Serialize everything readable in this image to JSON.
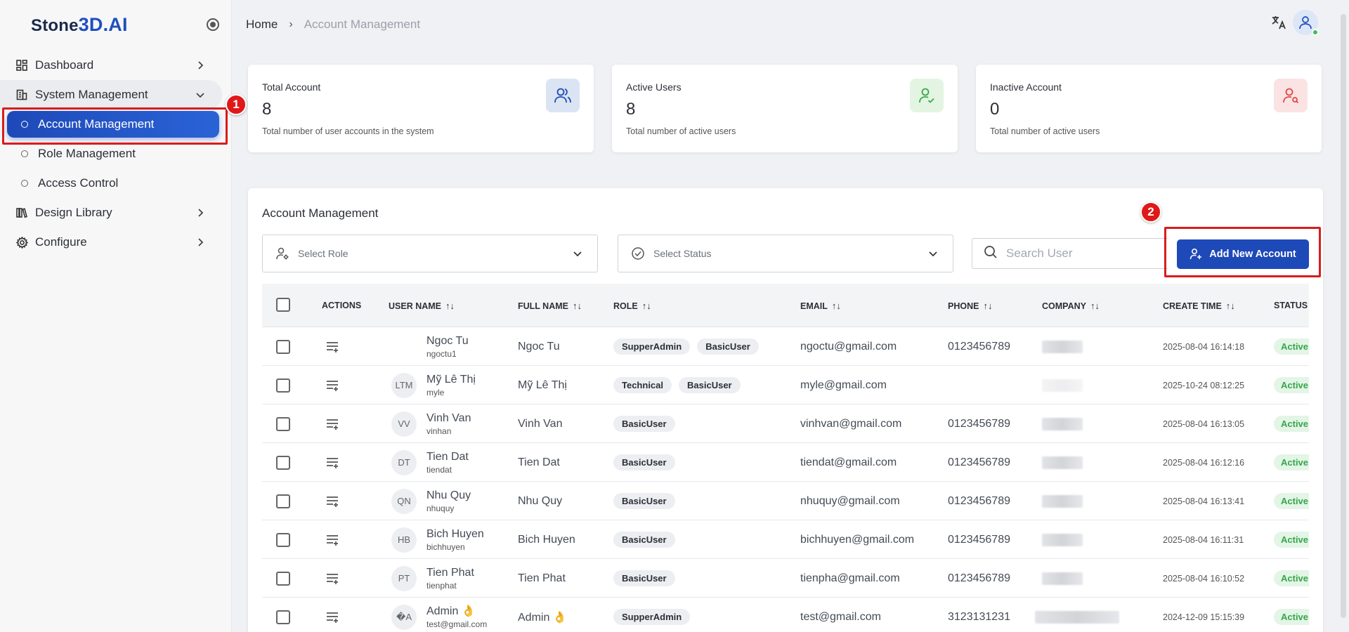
{
  "app": {
    "logo_prefix": "Stone",
    "logo_accent": "3D.AI"
  },
  "sidebar": {
    "items": [
      {
        "label": "Dashboard",
        "icon": "dashboard-icon"
      },
      {
        "label": "System Management",
        "icon": "building-icon"
      },
      {
        "label": "Account Management"
      },
      {
        "label": "Role Management"
      },
      {
        "label": "Access Control"
      },
      {
        "label": "Design Library",
        "icon": "library-icon"
      },
      {
        "label": "Configure",
        "icon": "gear-icon"
      }
    ]
  },
  "header": {
    "breadcrumb_home": "Home",
    "breadcrumb_sep": "›",
    "breadcrumb_current": "Account Management"
  },
  "annotations": {
    "one": "1",
    "two": "2"
  },
  "stats": [
    {
      "title": "Total Account",
      "value": "8",
      "desc": "Total number of user accounts in the system",
      "accent": "#dbe4f3"
    },
    {
      "title": "Active Users",
      "value": "8",
      "desc": "Total number of active users",
      "accent": "#e3f5e2"
    },
    {
      "title": "Inactive Account",
      "value": "0",
      "desc": "Total number of active users",
      "accent": "#fbe3e3"
    }
  ],
  "panel": {
    "title": "Account Management",
    "select_role": "Select Role",
    "select_status": "Select Status",
    "search_placeholder": "Search User",
    "add_button": "Add New Account"
  },
  "table": {
    "headers": {
      "actions": "ACTIONS",
      "username": "USER NAME",
      "fullname": "FULL NAME",
      "role": "ROLE",
      "email": "EMAIL",
      "phone": "PHONE",
      "company": "COMPANY",
      "created": "CREATE TIME",
      "status": "STATUS",
      "sort_glyph": "↑↓"
    },
    "rows": [
      {
        "initials": "",
        "name": "Ngoc Tu",
        "user": "ngoctu1",
        "full": "Ngoc Tu",
        "roles": [
          "SupperAdmin",
          "BasicUser"
        ],
        "email": "ngoctu@gmail.com",
        "phone": "0123456789",
        "created": "2025-08-04 16:14:18",
        "status": "Active"
      },
      {
        "initials": "LTM",
        "name": "Mỹ Lê Thị",
        "user": "myle",
        "full": "Mỹ Lê Thị",
        "roles": [
          "Technical",
          "BasicUser"
        ],
        "email": "myle@gmail.com",
        "phone": "",
        "created": "2025-10-24 08:12:25",
        "status": "Active"
      },
      {
        "initials": "VV",
        "name": "Vinh Van",
        "user": "vinhan",
        "full": "Vinh Van",
        "roles": [
          "BasicUser"
        ],
        "email": "vinhvan@gmail.com",
        "phone": "0123456789",
        "created": "2025-08-04 16:13:05",
        "status": "Active"
      },
      {
        "initials": "DT",
        "name": "Tien Dat",
        "user": "tiendat",
        "full": "Tien Dat",
        "roles": [
          "BasicUser"
        ],
        "email": "tiendat@gmail.com",
        "phone": "0123456789",
        "created": "2025-08-04 16:12:16",
        "status": "Active"
      },
      {
        "initials": "QN",
        "name": "Nhu Quy",
        "user": "nhuquy",
        "full": "Nhu Quy",
        "roles": [
          "BasicUser"
        ],
        "email": "nhuquy@gmail.com",
        "phone": "0123456789",
        "created": "2025-08-04 16:13:41",
        "status": "Active"
      },
      {
        "initials": "HB",
        "name": "Bich Huyen",
        "user": "bichhuyen",
        "full": "Bich Huyen",
        "roles": [
          "BasicUser"
        ],
        "email": "bichhuyen@gmail.com",
        "phone": "0123456789",
        "created": "2025-08-04 16:11:31",
        "status": "Active"
      },
      {
        "initials": "PT",
        "name": "Tien Phat",
        "user": "tienphat",
        "full": "Tien Phat",
        "roles": [
          "BasicUser"
        ],
        "email": "tienpha@gmail.com",
        "phone": "0123456789",
        "created": "2025-08-04 16:10:52",
        "status": "Active"
      },
      {
        "initials": "�A",
        "name": "Admin 👌",
        "user": "test@gmail.com",
        "full": "Admin 👌",
        "roles": [
          "SupperAdmin"
        ],
        "email": "test@gmail.com",
        "phone": "3123131231",
        "created": "2024-12-09 15:15:39",
        "status": "Active"
      }
    ]
  }
}
